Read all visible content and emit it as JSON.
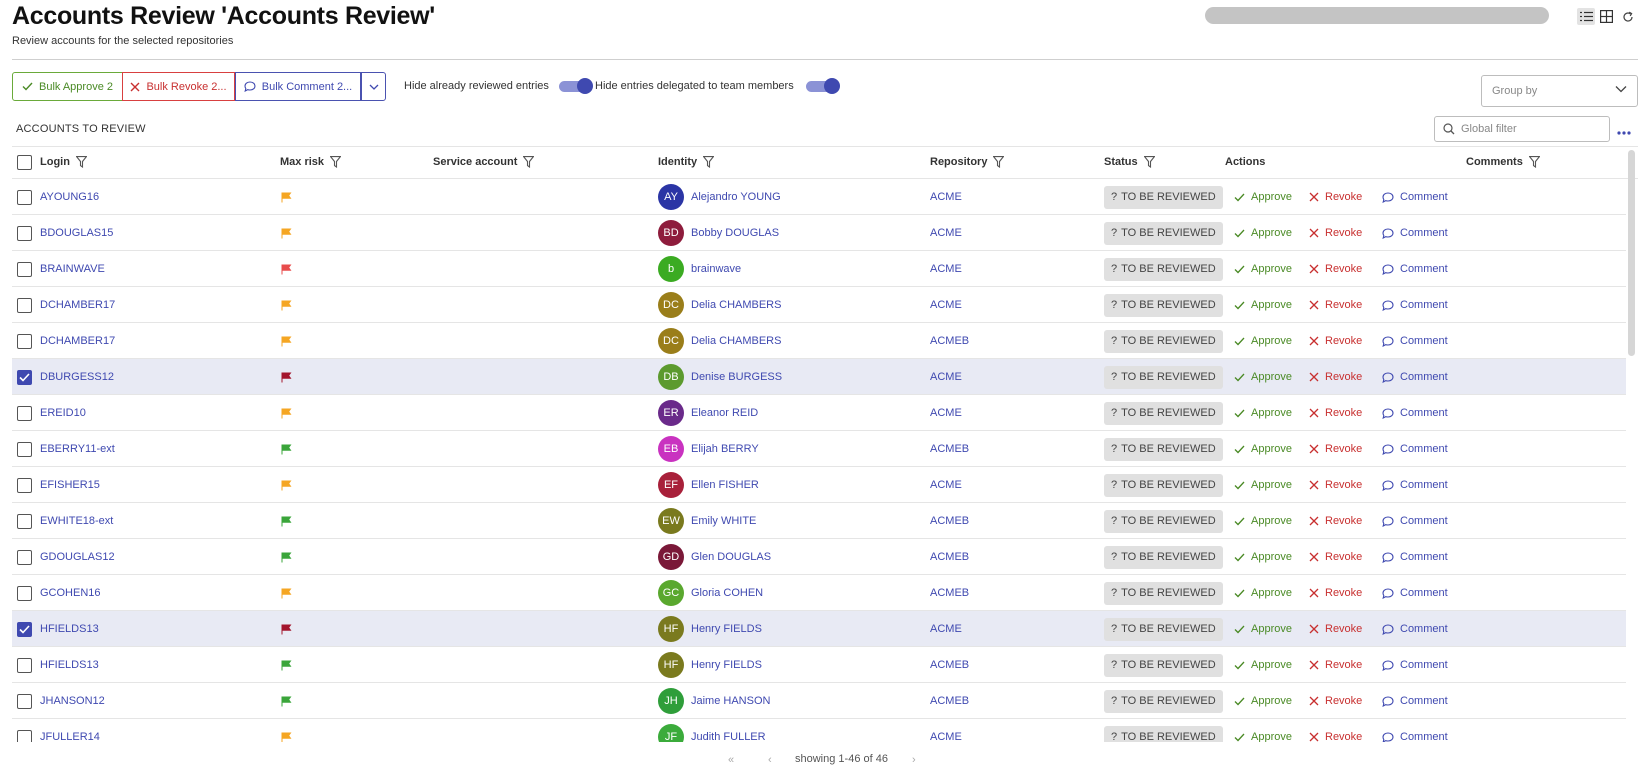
{
  "header": {
    "title": "Accounts Review 'Accounts Review'",
    "subtitle": "Review accounts for the selected repositories"
  },
  "toolbar": {
    "bulk_approve": "Bulk Approve 2",
    "bulk_revoke": "Bulk Revoke 2...",
    "bulk_comment": "Bulk Comment 2...",
    "toggle_reviewed_label": "Hide already reviewed entries",
    "toggle_delegated_label": "Hide entries delegated to team members",
    "group_by_placeholder": "Group by"
  },
  "section": {
    "title": "ACCOUNTS TO REVIEW",
    "filter_placeholder": "Global filter"
  },
  "columns": {
    "login": "Login",
    "max_risk": "Max risk",
    "service_account": "Service account",
    "identity": "Identity",
    "repository": "Repository",
    "status": "Status",
    "actions": "Actions",
    "comments": "Comments"
  },
  "actions": {
    "approve": "Approve",
    "revoke": "Revoke",
    "comment": "Comment"
  },
  "colors": {
    "risk_orange": "#f5a623",
    "risk_red": "#e84c4c",
    "risk_darkred": "#a3152d",
    "risk_green": "#3aa53a"
  },
  "rows": [
    {
      "login": "AYOUNG16",
      "risk": "orange",
      "initials": "AY",
      "avatar_color": "#2b35a5",
      "identity": "Alejandro YOUNG",
      "repository": "ACME",
      "status": "TO BE REVIEWED",
      "selected": false
    },
    {
      "login": "BDOUGLAS15",
      "risk": "orange",
      "initials": "BD",
      "avatar_color": "#8e1c3c",
      "identity": "Bobby DOUGLAS",
      "repository": "ACME",
      "status": "TO BE REVIEWED",
      "selected": false
    },
    {
      "login": "BRAINWAVE",
      "risk": "red",
      "initials": "b",
      "avatar_color": "#3bab22",
      "identity": "brainwave",
      "repository": "ACME",
      "status": "TO BE REVIEWED",
      "selected": false
    },
    {
      "login": "DCHAMBER17",
      "risk": "orange",
      "initials": "DC",
      "avatar_color": "#9a7e1a",
      "identity": "Delia CHAMBERS",
      "repository": "ACME",
      "status": "TO BE REVIEWED",
      "selected": false
    },
    {
      "login": "DCHAMBER17",
      "risk": "orange",
      "initials": "DC",
      "avatar_color": "#9a7e1a",
      "identity": "Delia CHAMBERS",
      "repository": "ACMEB",
      "status": "TO BE REVIEWED",
      "selected": false
    },
    {
      "login": "DBURGESS12",
      "risk": "darkred",
      "initials": "DB",
      "avatar_color": "#5c9a2e",
      "identity": "Denise BURGESS",
      "repository": "ACME",
      "status": "TO BE REVIEWED",
      "selected": true
    },
    {
      "login": "EREID10",
      "risk": "orange",
      "initials": "ER",
      "avatar_color": "#6a2a8a",
      "identity": "Eleanor REID",
      "repository": "ACME",
      "status": "TO BE REVIEWED",
      "selected": false
    },
    {
      "login": "EBERRY11-ext",
      "risk": "green",
      "initials": "EB",
      "avatar_color": "#c932c0",
      "identity": "Elijah BERRY",
      "repository": "ACMEB",
      "status": "TO BE REVIEWED",
      "selected": false
    },
    {
      "login": "EFISHER15",
      "risk": "orange",
      "initials": "EF",
      "avatar_color": "#a8203a",
      "identity": "Ellen FISHER",
      "repository": "ACME",
      "status": "TO BE REVIEWED",
      "selected": false
    },
    {
      "login": "EWHITE18-ext",
      "risk": "green",
      "initials": "EW",
      "avatar_color": "#7a7a1e",
      "identity": "Emily WHITE",
      "repository": "ACMEB",
      "status": "TO BE REVIEWED",
      "selected": false
    },
    {
      "login": "GDOUGLAS12",
      "risk": "green",
      "initials": "GD",
      "avatar_color": "#7a1838",
      "identity": "Glen DOUGLAS",
      "repository": "ACMEB",
      "status": "TO BE REVIEWED",
      "selected": false
    },
    {
      "login": "GCOHEN16",
      "risk": "orange",
      "initials": "GC",
      "avatar_color": "#5aa82e",
      "identity": "Gloria COHEN",
      "repository": "ACMEB",
      "status": "TO BE REVIEWED",
      "selected": false
    },
    {
      "login": "HFIELDS13",
      "risk": "darkred",
      "initials": "HF",
      "avatar_color": "#7a7a1e",
      "identity": "Henry FIELDS",
      "repository": "ACME",
      "status": "TO BE REVIEWED",
      "selected": true
    },
    {
      "login": "HFIELDS13",
      "risk": "green",
      "initials": "HF",
      "avatar_color": "#7a7a1e",
      "identity": "Henry FIELDS",
      "repository": "ACMEB",
      "status": "TO BE REVIEWED",
      "selected": false
    },
    {
      "login": "JHANSON12",
      "risk": "green",
      "initials": "JH",
      "avatar_color": "#2f9e3a",
      "identity": "Jaime HANSON",
      "repository": "ACMEB",
      "status": "TO BE REVIEWED",
      "selected": false
    },
    {
      "login": "JFULLER14",
      "risk": "orange",
      "initials": "JF",
      "avatar_color": "#3bab3b",
      "identity": "Judith FULLER",
      "repository": "ACME",
      "status": "TO BE REVIEWED",
      "selected": false
    }
  ],
  "pagination": {
    "text": "showing 1-46 of 46"
  }
}
